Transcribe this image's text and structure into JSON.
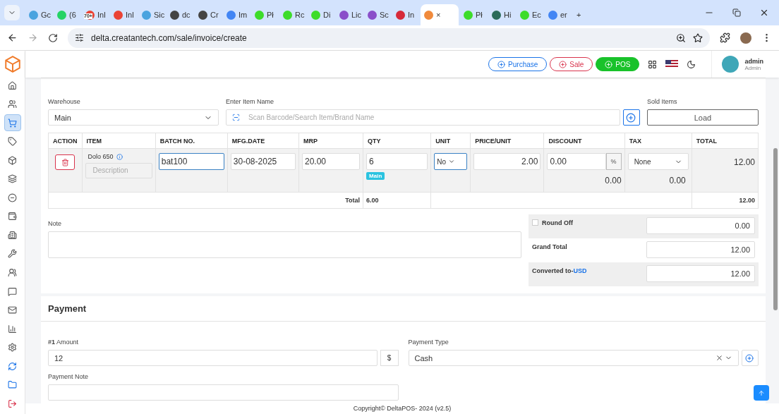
{
  "browser": {
    "tabs": [
      {
        "label": "Gc",
        "color": "#4aa3df",
        "selected": false
      },
      {
        "label": "(6",
        "color": "#25d366",
        "selected": false
      },
      {
        "label": "Inl",
        "color": "#ea4335",
        "badge": "70+",
        "selected": false
      },
      {
        "label": "Inl",
        "color": "#ea4335",
        "selected": false
      },
      {
        "label": "Sic",
        "color": "#4aa3df",
        "selected": false
      },
      {
        "label": "dc",
        "color": "#444444",
        "selected": false
      },
      {
        "label": "Cr",
        "color": "#444444",
        "selected": false
      },
      {
        "label": "Im",
        "color": "#4285f4",
        "selected": false
      },
      {
        "label": "Pł",
        "color": "#3ddc2a",
        "selected": false
      },
      {
        "label": "Rc",
        "color": "#3ddc2a",
        "selected": false
      },
      {
        "label": "Di",
        "color": "#3ddc2a",
        "selected": false
      },
      {
        "label": "Lic",
        "color": "#8a4fc9",
        "selected": false
      },
      {
        "label": "Sc",
        "color": "#8a4fc9",
        "selected": false
      },
      {
        "label": "In",
        "color": "#d62a3a",
        "selected": false
      },
      {
        "label": "×",
        "color": "#f08a3c",
        "selected": true
      },
      {
        "label": "Pł",
        "color": "#3ddc2a",
        "selected": false
      },
      {
        "label": "Hi",
        "color": "#2a6b5a",
        "selected": false
      },
      {
        "label": "Ec",
        "color": "#3ddc2a",
        "selected": false
      },
      {
        "label": "er",
        "color": "#4285f4",
        "selected": false
      }
    ],
    "new_tab": "+",
    "url": "delta.creatantech.com/sale/invoice/create"
  },
  "sidebar": {
    "items": [
      {
        "selected": false
      },
      {
        "selected": false
      },
      {
        "selected": true
      },
      {
        "selected": false
      },
      {
        "selected": false
      },
      {
        "selected": false
      },
      {
        "selected": false
      },
      {
        "selected": false
      },
      {
        "selected": false
      },
      {
        "selected": false
      },
      {
        "selected": false
      },
      {
        "selected": false
      },
      {
        "selected": false
      },
      {
        "selected": false
      },
      {
        "selected": false
      },
      {
        "selected": false
      },
      {
        "selected": false
      },
      {
        "selected": false
      }
    ]
  },
  "header": {
    "buttons": [
      {
        "label": "Purchase",
        "kind": "purchase"
      },
      {
        "label": "Sale",
        "kind": "sale"
      },
      {
        "label": "POS",
        "kind": "pos"
      }
    ],
    "user": {
      "name": "admin",
      "role": "Admin"
    }
  },
  "items": {
    "warehouse": {
      "label": "Warehouse",
      "value": "Main"
    },
    "item_name": {
      "label": "Enter Item Name",
      "placeholder": "Scan Barcode/Search Item/Brand Name"
    },
    "sold_items": {
      "label": "Sold Items",
      "button": "Load"
    },
    "table": {
      "columns": [
        "ACTION",
        "ITEM",
        "BATCH NO.",
        "MFG.DATE",
        "MRP",
        "QTY",
        "UNIT",
        "PRICE/UNIT",
        "DISCOUNT",
        "TAX",
        "TOTAL"
      ],
      "rows": [
        {
          "item": "Dolo 650",
          "description_placeholder": "Description",
          "batch": "bat100",
          "mfg_date": "30-08-2025",
          "mrp": "20.00",
          "qty": "6",
          "stock_badge": "Main",
          "unit": "No",
          "price": "2.00",
          "discount": "0.00",
          "discount_type": "%",
          "discount_amount": "0.00",
          "tax": "None",
          "tax_amount": "0.00",
          "total": "12.00"
        }
      ],
      "footer": {
        "label": "Total",
        "qty": "6.00",
        "total": "12.00"
      }
    }
  },
  "note": {
    "label": "Note"
  },
  "summary": {
    "round_off": {
      "label": "Round Off",
      "checked": false,
      "value": "0.00"
    },
    "grand_total": {
      "label": "Grand Total",
      "value": "12.00"
    },
    "converted": {
      "label": "Converted to-",
      "currency": "USD",
      "value": "12.00"
    }
  },
  "payment": {
    "title": "Payment",
    "amount_label": "**#1** Amount",
    "amount": "12",
    "currency": "$",
    "type_label": "Payment Type",
    "type": "Cash",
    "note_label": "Payment Note"
  },
  "footer": "Copyright© DeltaPOS- 2024 (v2.5)"
}
